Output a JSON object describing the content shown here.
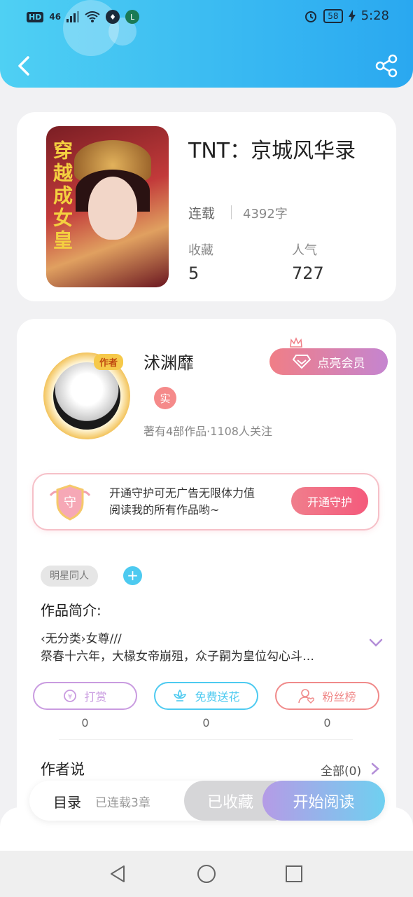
{
  "status_bar": {
    "hd": "HD",
    "network": "46",
    "battery": "58",
    "time": "5:28"
  },
  "book": {
    "title": "TNT：京城风华录",
    "status": "连载",
    "word_count": "4392字",
    "favorites_label": "收藏",
    "favorites_value": "5",
    "popularity_label": "人气",
    "popularity_value": "727",
    "cover_text": "穿越成女皇"
  },
  "author": {
    "tag": "作者",
    "name": "沭渊靡",
    "verified_badge": "实",
    "meta": "著有4部作品·1108人关注",
    "vip_button": "点亮会员"
  },
  "guard": {
    "shield_text": "守",
    "line1": "开通守护可无广告无限体力值",
    "line2": "阅读我的所有作品哟~",
    "button": "开通守护"
  },
  "tags": [
    "明星同人"
  ],
  "tag_add": "+",
  "intro": {
    "title": "作品简介:",
    "line1": "‹无分类›女尊///",
    "line2": "祭春十六年，大椽女帝崩殂，众子嗣为皇位勾心斗…"
  },
  "actions": [
    {
      "label": "打赏",
      "count": "0",
      "color": "#c99be0"
    },
    {
      "label": "免费送花",
      "count": "0",
      "color": "#4dcaf0"
    },
    {
      "label": "粉丝榜",
      "count": "0",
      "color": "#f08a8a"
    }
  ],
  "author_says": {
    "title": "作者说",
    "all": "全部(0)"
  },
  "bottom_bar": {
    "toc": "目录",
    "chapters": "已连载3章",
    "collected": "已收藏",
    "start": "开始阅读"
  },
  "colors": {
    "header": "#38b8f2",
    "accent_blue": "#4dcaf0",
    "accent_pink": "#f07e8c",
    "accent_purple": "#b59be6"
  }
}
